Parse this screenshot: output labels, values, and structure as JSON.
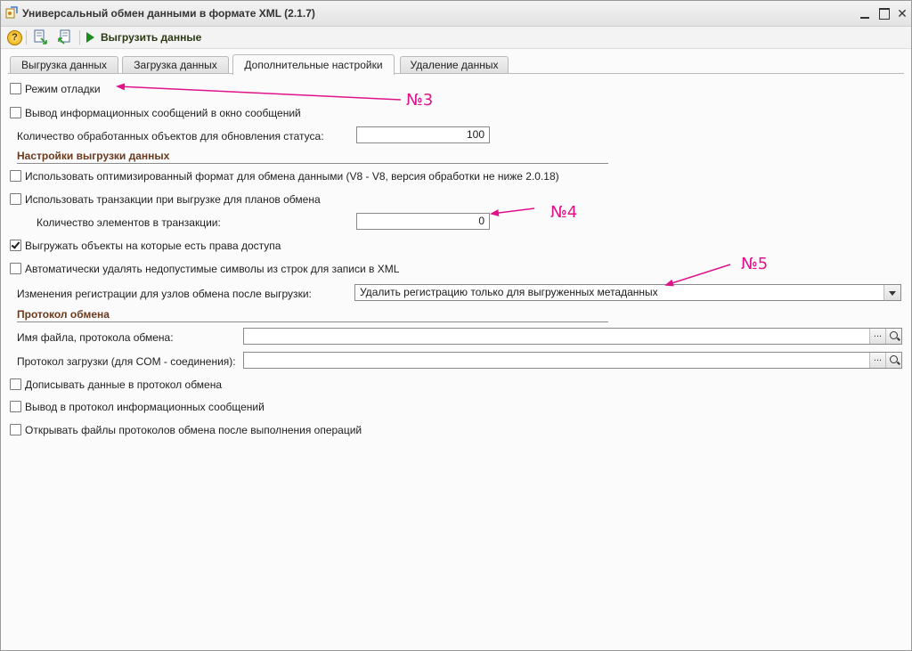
{
  "window": {
    "title": "Универсальный обмен данными в формате XML (2.1.7)"
  },
  "toolbar": {
    "help_label": "?",
    "run_label": "Выгрузить данные"
  },
  "tabs": [
    {
      "label": "Выгрузка данных",
      "active": false
    },
    {
      "label": "Загрузка данных",
      "active": false
    },
    {
      "label": "Дополнительные настройки",
      "active": true
    },
    {
      "label": "Удаление данных",
      "active": false
    }
  ],
  "settings": {
    "debug_mode": {
      "label": "Режим отладки",
      "checked": false
    },
    "info_messages": {
      "label": "Вывод информационных сообщений в окно сообщений",
      "checked": false
    },
    "status_count": {
      "label": "Количество обработанных объектов для обновления статуса:",
      "value": "100"
    }
  },
  "export_settings": {
    "section_title": "Настройки выгрузки данных",
    "optimized_format": {
      "label": "Использовать оптимизированный формат для обмена данными (V8 - V8, версия обработки не ниже 2.0.18)",
      "checked": false
    },
    "use_transactions": {
      "label": "Использовать транзакции при выгрузке для планов обмена",
      "checked": false
    },
    "transaction_count": {
      "label": "Количество элементов в транзакции:",
      "value": "0"
    },
    "access_rights": {
      "label": "Выгружать объекты на которые есть права доступа",
      "checked": true
    },
    "remove_invalid_chars": {
      "label": "Автоматически удалять недопустимые символы из строк для записи в XML",
      "checked": false
    },
    "registration_changes": {
      "label": "Изменения регистрации для узлов обмена после выгрузки:",
      "value": "Удалить регистрацию только для выгруженных метаданных"
    }
  },
  "protocol": {
    "section_title": "Протокол обмена",
    "file_name": {
      "label": "Имя файла, протокола обмена:",
      "value": ""
    },
    "load_protocol": {
      "label": "Протокол загрузки (для COM - соединения):",
      "value": ""
    },
    "select_button": "...",
    "append_data": {
      "label": "Дописывать данные в протокол обмена",
      "checked": false
    },
    "info_to_protocol": {
      "label": "Вывод в протокол информационных сообщений",
      "checked": false
    },
    "open_files": {
      "label": "Открывать файлы протоколов обмена после выполнения операций",
      "checked": false
    }
  },
  "annotations": [
    "№3",
    "№4",
    "№5"
  ],
  "colors": {
    "annotation": "#e0128a",
    "section_title": "#6b3a1c",
    "run_icon": "#1c8a1c"
  }
}
